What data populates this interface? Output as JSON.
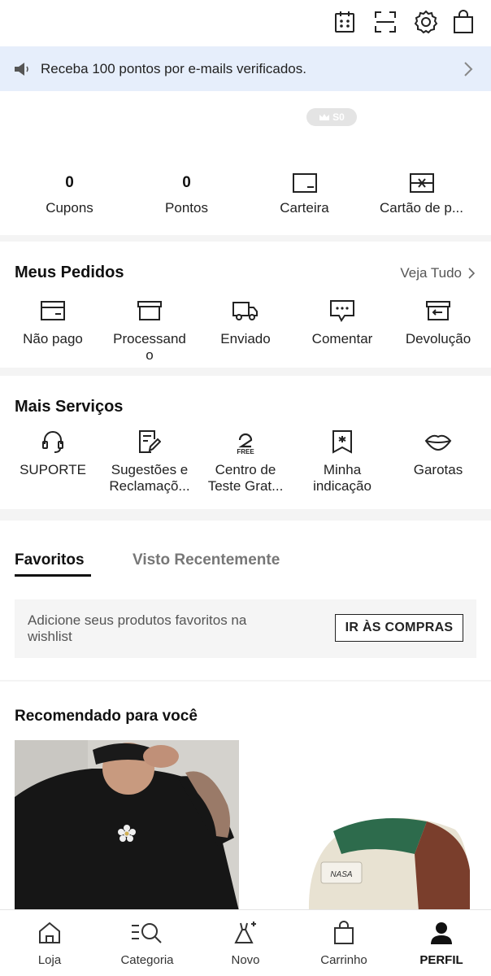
{
  "header": {
    "icons": [
      "calendar-checkin-icon",
      "scan-icon",
      "settings-gear-icon",
      "shopping-bag-icon"
    ]
  },
  "banner": {
    "text": "Receba 100 pontos por e-mails verificados."
  },
  "profile": {
    "badge_text": "S0",
    "stats": [
      {
        "value": "0",
        "label": "Cupons"
      },
      {
        "value": "0",
        "label": "Pontos"
      },
      {
        "label": "Carteira",
        "icon": "wallet-icon"
      },
      {
        "label": "Cartão de p...",
        "icon": "gift-card-icon"
      }
    ]
  },
  "orders": {
    "title": "Meus Pedidos",
    "view_all": "Veja Tudo",
    "items": [
      {
        "label": "Não pago",
        "icon": "wallet-unpaid-icon"
      },
      {
        "label": "Processand\no",
        "icon": "box-processing-icon"
      },
      {
        "label": "Enviado",
        "icon": "truck-icon"
      },
      {
        "label": "Comentar",
        "icon": "comment-icon"
      },
      {
        "label": "Devolução",
        "icon": "return-box-icon"
      }
    ]
  },
  "services": {
    "title": "Mais Serviços",
    "items": [
      {
        "label": "SUPORTE",
        "icon": "headset-icon"
      },
      {
        "label": "Sugestões e\nReclamaçõ...",
        "icon": "feedback-edit-icon"
      },
      {
        "label": "Centro de\nTeste Grat...",
        "icon": "free-trial-icon",
        "icon_text": "FREE"
      },
      {
        "label": "Minha\nindicação",
        "icon": "referral-icon"
      },
      {
        "label": "Garotas",
        "icon": "lips-icon"
      }
    ]
  },
  "favorites": {
    "tabs": [
      "Favoritos",
      "Visto Recentemente"
    ],
    "active_tab": "Favoritos",
    "empty_text": "Adicione seus produtos favoritos na wishlist",
    "button": "IR ÀS COMPRAS"
  },
  "recommended": {
    "title": "Recomendado para você",
    "cap_logo_text": "NASA"
  },
  "bottom_nav": {
    "items": [
      {
        "label": "Loja",
        "icon": "home-icon"
      },
      {
        "label": "Categoria",
        "icon": "category-search-icon"
      },
      {
        "label": "Novo",
        "icon": "new-dress-icon"
      },
      {
        "label": "Carrinho",
        "icon": "cart-bag-icon"
      },
      {
        "label": "PERFIL",
        "icon": "profile-icon"
      }
    ],
    "active": "PERFIL"
  }
}
